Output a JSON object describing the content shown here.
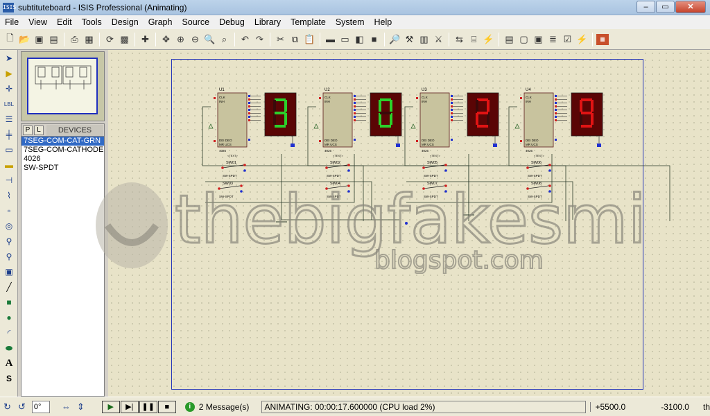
{
  "window": {
    "title": "subtituteboard - ISIS Professional (Animating)",
    "icon_text": "ISIS"
  },
  "menu": [
    "File",
    "View",
    "Edit",
    "Tools",
    "Design",
    "Graph",
    "Source",
    "Debug",
    "Library",
    "Template",
    "System",
    "Help"
  ],
  "devices": {
    "tab_p": "P",
    "tab_l": "L",
    "title": "DEVICES",
    "items": [
      "7SEG-COM-CAT-GRN",
      "7SEG-COM-CATHODE",
      "4026",
      "SW-SPDT"
    ],
    "selected_index": 0
  },
  "schematic": {
    "counters": [
      {
        "ref": "U1",
        "digit": "3",
        "color": "#2bd12b",
        "pins_left": [
          "CLK",
          "INH"
        ],
        "pins_bottom": [
          "DEI",
          "MR",
          "DEO",
          "UCS"
        ],
        "part": "4026",
        "tag": "<TEXT>"
      },
      {
        "ref": "U2",
        "digit": "0",
        "color": "#2bd12b",
        "pins_left": [
          "CLK",
          "INH"
        ],
        "pins_bottom": [
          "DEI",
          "MR",
          "DEO",
          "UCS"
        ],
        "part": "4026",
        "tag": "<TEXT>"
      },
      {
        "ref": "U3",
        "digit": "2",
        "color": "#e01414",
        "pins_left": [
          "CLK",
          "INH"
        ],
        "pins_bottom": [
          "DEI",
          "MR",
          "DEO",
          "UCS"
        ],
        "part": "4026",
        "tag": "<TEXT>"
      },
      {
        "ref": "U4",
        "digit": "9",
        "color": "#e01414",
        "pins_left": [
          "CLK",
          "INH"
        ],
        "pins_bottom": [
          "DEI",
          "MR",
          "DEO",
          "UCS"
        ],
        "part": "4026",
        "tag": "<TEXT>"
      }
    ],
    "switches": [
      {
        "ref": "SW01",
        "part": "SW-SPDT"
      },
      {
        "ref": "SW02",
        "part": "SW-SPDT"
      },
      {
        "ref": "SW03",
        "part": "SW-SPDT"
      },
      {
        "ref": "SW04",
        "part": "SW-SPDT"
      },
      {
        "ref": "SW05",
        "part": "SW-SPDT"
      },
      {
        "ref": "SW06",
        "part": "SW-SPDT"
      },
      {
        "ref": "SW07",
        "part": "SW-SPDT"
      },
      {
        "ref": "SW08",
        "part": "SW-SPDT"
      }
    ]
  },
  "watermark": {
    "main": "thebigfakesmile",
    "sub": "blogspot.com"
  },
  "status": {
    "rotation": "0°",
    "messages": "2 Message(s)",
    "animating": "ANIMATING: 00:00:17.600000 (CPU load 2%)",
    "x": "+5500.0",
    "y": "-3100.0",
    "units": "th"
  }
}
